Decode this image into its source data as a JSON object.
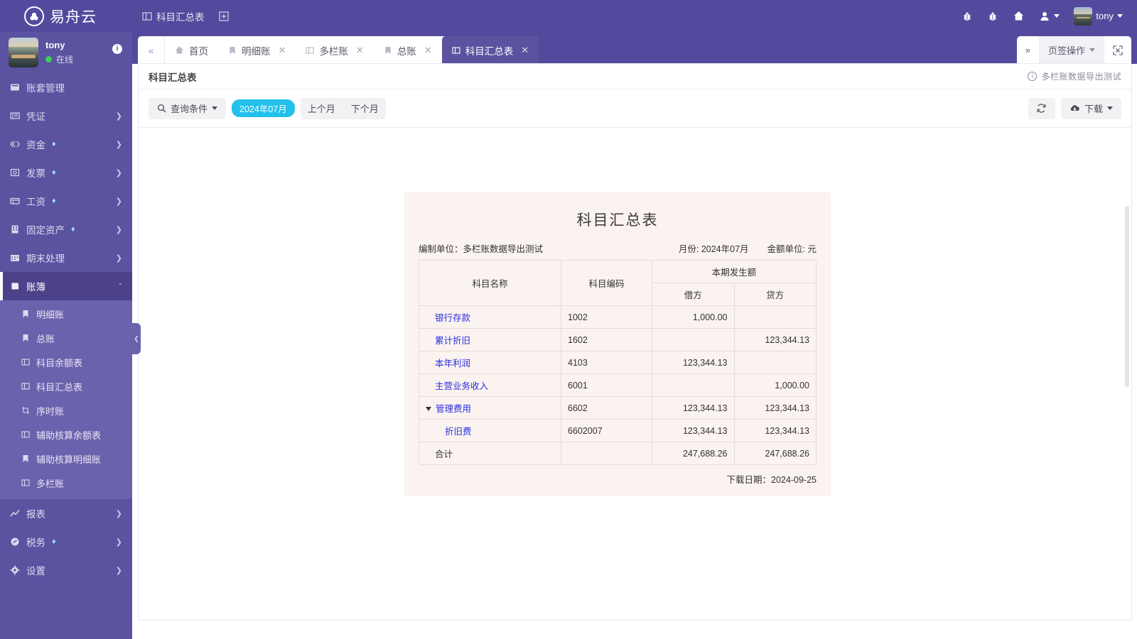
{
  "brand": {
    "name": "易舟云"
  },
  "topbar": {
    "menu": [
      {
        "label": "科目汇总表",
        "icon": "panel-icon"
      }
    ],
    "add_label": "",
    "right_items": [
      {
        "name": "bug-icon-1",
        "label": ""
      },
      {
        "name": "bug-icon-2",
        "label": ""
      },
      {
        "name": "home-icon",
        "label": ""
      },
      {
        "name": "user-switch",
        "label": ""
      }
    ],
    "user": {
      "name": "tony"
    }
  },
  "sidebar": {
    "profile": {
      "name": "tony",
      "status": "在线",
      "badge": "i"
    },
    "items": [
      {
        "label": "账套管理",
        "icon": "book-cover-icon",
        "expandable": false,
        "pro": false
      },
      {
        "label": "凭证",
        "icon": "voucher-icon",
        "expandable": true,
        "pro": false
      },
      {
        "label": "资金",
        "icon": "fund-icon",
        "expandable": true,
        "pro": true
      },
      {
        "label": "发票",
        "icon": "invoice-icon",
        "expandable": true,
        "pro": true
      },
      {
        "label": "工资",
        "icon": "salary-icon",
        "expandable": true,
        "pro": true
      },
      {
        "label": "固定资产",
        "icon": "asset-icon",
        "expandable": true,
        "pro": true
      },
      {
        "label": "期末处理",
        "icon": "calendar-icon",
        "expandable": true,
        "pro": false
      },
      {
        "label": "账簿",
        "icon": "ledger-icon",
        "expandable": true,
        "pro": false,
        "active": true
      },
      {
        "label": "报表",
        "icon": "chart-icon",
        "expandable": true,
        "pro": false
      },
      {
        "label": "税务",
        "icon": "tax-icon",
        "expandable": true,
        "pro": true
      },
      {
        "label": "设置",
        "icon": "gear-icon",
        "expandable": true,
        "pro": false
      }
    ],
    "submenu": [
      {
        "label": "明细账",
        "icon": "bookmark-icon"
      },
      {
        "label": "总账",
        "icon": "bookmark-icon"
      },
      {
        "label": "科目余额表",
        "icon": "panel-icon"
      },
      {
        "label": "科目汇总表",
        "icon": "panel-icon"
      },
      {
        "label": "序时账",
        "icon": "crop-icon"
      },
      {
        "label": "辅助核算余额表",
        "icon": "panel-icon"
      },
      {
        "label": "辅助核算明细账",
        "icon": "bookmark-icon"
      },
      {
        "label": "多栏账",
        "icon": "panel-icon"
      }
    ]
  },
  "tabs": {
    "items": [
      {
        "label": "首页",
        "icon": "home-icon",
        "closable": false,
        "active": false
      },
      {
        "label": "明细账",
        "icon": "bookmark-icon",
        "closable": true,
        "active": false
      },
      {
        "label": "多栏账",
        "icon": "panel-icon",
        "closable": true,
        "active": false
      },
      {
        "label": "总账",
        "icon": "bookmark-icon",
        "closable": true,
        "active": false
      },
      {
        "label": "科目汇总表",
        "icon": "panel-icon",
        "closable": true,
        "active": true
      }
    ],
    "right": {
      "ops_label": "页签操作"
    }
  },
  "page": {
    "title": "科目汇总表",
    "book_name": "多栏账数据导出测试"
  },
  "toolbar": {
    "query_label": "查询条件",
    "month_badge": "2024年07月",
    "prev_month": "上个月",
    "next_month": "下个月",
    "download_label": "下载"
  },
  "report": {
    "title": "科目汇总表",
    "unit_label": "编制单位：多栏账数据导出测试",
    "period_label": "月份: 2024年07月",
    "currency_label": "金额单位: 元",
    "headers": {
      "name": "科目名称",
      "code": "科目编码",
      "group": "本期发生额",
      "debit": "借方",
      "credit": "贷方"
    },
    "rows": [
      {
        "name": "银行存款",
        "code": "1002",
        "debit": "1,000.00",
        "credit": "",
        "link": true,
        "level": 0,
        "toggle": false
      },
      {
        "name": "累计折旧",
        "code": "1602",
        "debit": "",
        "credit": "123,344.13",
        "link": true,
        "level": 0,
        "toggle": false
      },
      {
        "name": "本年利润",
        "code": "4103",
        "debit": "123,344.13",
        "credit": "",
        "link": true,
        "level": 0,
        "toggle": false
      },
      {
        "name": "主营业务收入",
        "code": "6001",
        "debit": "",
        "credit": "1,000.00",
        "link": true,
        "level": 0,
        "toggle": false
      },
      {
        "name": "管理费用",
        "code": "6602",
        "debit": "123,344.13",
        "credit": "123,344.13",
        "link": true,
        "level": 0,
        "toggle": true
      },
      {
        "name": "折旧费",
        "code": "6602007",
        "debit": "123,344.13",
        "credit": "123,344.13",
        "link": true,
        "level": 1,
        "toggle": false
      }
    ],
    "total": {
      "name": "合计",
      "code": "",
      "debit": "247,688.26",
      "credit": "247,688.26"
    },
    "footer": "下载日期：2024-09-25"
  },
  "colors": {
    "brand_purple": "#544a9d",
    "sidebar_purple": "#5b52a0",
    "submenu_purple": "#6b62ad",
    "accent_cyan": "#22c1ec",
    "report_bg": "#faf3ef",
    "link_blue": "#2b2ce0"
  }
}
